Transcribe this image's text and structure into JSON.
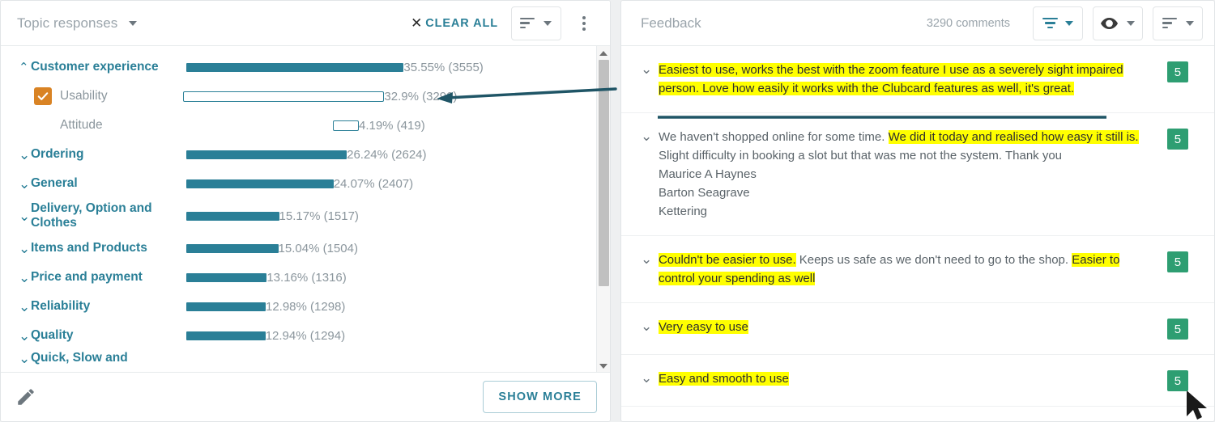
{
  "left_panel": {
    "title": "Topic responses",
    "clear_all": "CLEAR ALL",
    "x_icon": "close-icon",
    "sort_icon": "sort-icon",
    "kebab_icon": "more-vertical-icon",
    "footer": {
      "edit_icon": "pencil-icon",
      "show_more": "SHOW MORE"
    },
    "topics": [
      {
        "label": "Customer experience",
        "percent": "35.55%",
        "count": "(3555)",
        "value_text": "35.55% (3555)",
        "bar_pct": 35.55,
        "level": "parent",
        "expanded": true,
        "selected": false
      },
      {
        "label": "Usability",
        "percent": "32.9%",
        "count": "(3290)",
        "value_text": "32.9% (3290)",
        "bar_pct": 32.9,
        "level": "child",
        "expanded": false,
        "selected": true
      },
      {
        "label": "Attitude",
        "percent": "4.19%",
        "count": "(419)",
        "value_text": "4.19% (419)",
        "bar_pct": 4.19,
        "level": "child",
        "expanded": false,
        "selected": false
      },
      {
        "label": "Ordering",
        "percent": "26.24%",
        "count": "(2624)",
        "value_text": "26.24% (2624)",
        "bar_pct": 26.24,
        "level": "parent",
        "expanded": false,
        "selected": false
      },
      {
        "label": "General",
        "percent": "24.07%",
        "count": "(2407)",
        "value_text": "24.07% (2407)",
        "bar_pct": 24.07,
        "level": "parent",
        "expanded": false,
        "selected": false
      },
      {
        "label": "Delivery, Option and Clothes",
        "percent": "15.17%",
        "count": "(1517)",
        "value_text": "15.17% (1517)",
        "bar_pct": 15.17,
        "level": "parent",
        "expanded": false,
        "selected": false
      },
      {
        "label": "Items and Products",
        "percent": "15.04%",
        "count": "(1504)",
        "value_text": "15.04% (1504)",
        "bar_pct": 15.04,
        "level": "parent",
        "expanded": false,
        "selected": false
      },
      {
        "label": "Price and payment",
        "percent": "13.16%",
        "count": "(1316)",
        "value_text": "13.16% (1316)",
        "bar_pct": 13.16,
        "level": "parent",
        "expanded": false,
        "selected": false
      },
      {
        "label": "Reliability",
        "percent": "12.98%",
        "count": "(1298)",
        "value_text": "12.98% (1298)",
        "bar_pct": 12.98,
        "level": "parent",
        "expanded": false,
        "selected": false
      },
      {
        "label": "Quality",
        "percent": "12.94%",
        "count": "(1294)",
        "value_text": "12.94% (1294)",
        "bar_pct": 12.94,
        "level": "parent",
        "expanded": false,
        "selected": false
      },
      {
        "label": "Quick, Slow and",
        "percent": "",
        "count": "",
        "value_text": "",
        "bar_pct": 0,
        "level": "parent",
        "expanded": false,
        "selected": false
      }
    ]
  },
  "right_panel": {
    "title": "Feedback",
    "comment_count": "3290 comments",
    "filter_icon": "filter-icon",
    "visibility_icon": "eye-icon",
    "sort_icon": "sort-icon",
    "comments": [
      {
        "score": "5",
        "chevron_icon": "chevron-down-icon",
        "segments": [
          {
            "text": "Easiest to use, works the best with the zoom feature I use as a severely sight impaired person. Love how easily it works with the Clubcard features as well, it's great.",
            "highlighted": true
          }
        ]
      },
      {
        "score": "5",
        "chevron_icon": "chevron-down-icon",
        "segments": [
          {
            "text": "We haven't shopped online for some time. ",
            "highlighted": false
          },
          {
            "text": "We did it today and realised how easy it still is.",
            "highlighted": true
          },
          {
            "text": "\nSlight difficulty in booking a slot but that was me not the system. Thank you\nMaurice A Haynes\nBarton Seagrave\nKettering",
            "highlighted": false
          }
        ]
      },
      {
        "score": "5",
        "chevron_icon": "chevron-down-icon",
        "segments": [
          {
            "text": "Couldn't be easier to use.",
            "highlighted": true
          },
          {
            "text": " Keeps us safe as we don't need to go to the shop. ",
            "highlighted": false
          },
          {
            "text": "Easier to control your spending as well",
            "highlighted": true
          }
        ]
      },
      {
        "score": "5",
        "chevron_icon": "chevron-down-icon",
        "segments": [
          {
            "text": "Very easy to use",
            "highlighted": true
          }
        ]
      },
      {
        "score": "5",
        "chevron_icon": "chevron-down-icon",
        "segments": [
          {
            "text": "Easy and smooth to use",
            "highlighted": true
          }
        ]
      }
    ]
  },
  "annotation": {
    "arrow_icon": "left-arrow-annotation",
    "underline_icon": "underline-annotation",
    "color": "#1f5566"
  },
  "colors": {
    "teal": "#2a7f97",
    "orange": "#d98324",
    "green": "#2e9e72",
    "highlight": "#ffff00",
    "muted": "#8b969d"
  }
}
